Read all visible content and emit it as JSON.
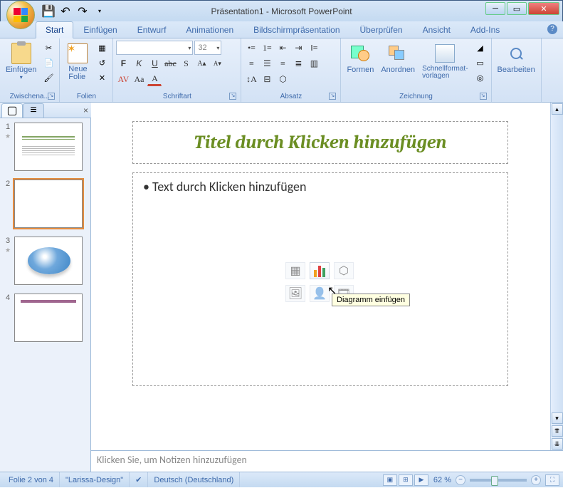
{
  "titlebar": {
    "document": "Präsentation1",
    "app": "Microsoft PowerPoint"
  },
  "tabs": [
    "Start",
    "Einfügen",
    "Entwurf",
    "Animationen",
    "Bildschirmpräsentation",
    "Überprüfen",
    "Ansicht",
    "Add-Ins"
  ],
  "active_tab": 0,
  "ribbon": {
    "clipboard": {
      "label": "Zwischena...",
      "paste": "Einfügen"
    },
    "slides": {
      "label": "Folien",
      "new_slide": "Neue\nFolie"
    },
    "font": {
      "label": "Schriftart",
      "size": "32"
    },
    "paragraph": {
      "label": "Absatz"
    },
    "drawing": {
      "label": "Zeichnung",
      "shapes": "Formen",
      "arrange": "Anordnen",
      "quick": "Schnellformat-\nvorlagen"
    },
    "editing": {
      "label": "Bearbeiten"
    }
  },
  "slide": {
    "title_placeholder": "Titel durch Klicken hinzufügen",
    "content_placeholder": "Text durch Klicken hinzufügen",
    "tooltip": "Diagramm einfügen"
  },
  "notes_placeholder": "Klicken Sie, um Notizen hinzuzufügen",
  "thumbnails": [
    {
      "num": "1"
    },
    {
      "num": "2"
    },
    {
      "num": "3"
    },
    {
      "num": "4"
    }
  ],
  "status": {
    "slide_info": "Folie 2 von 4",
    "theme": "\"Larissa-Design\"",
    "language": "Deutsch (Deutschland)",
    "zoom": "62 %"
  }
}
